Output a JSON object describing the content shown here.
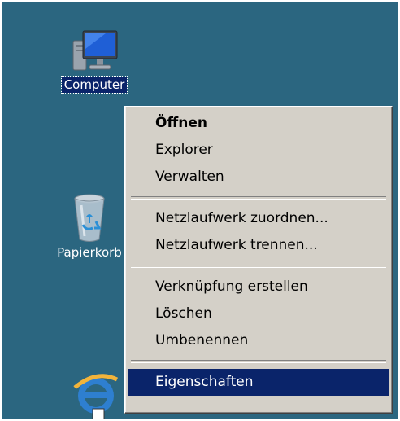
{
  "desktop": {
    "icons": [
      {
        "label": "Computer",
        "icon": "computer-monitor-icon"
      },
      {
        "label": "Papierkorb",
        "icon": "recycle-bin-icon"
      },
      {
        "label": "",
        "icon": "internet-explorer-icon"
      }
    ]
  },
  "context_menu": {
    "items": [
      {
        "label": "Öffnen",
        "bold": true
      },
      {
        "label": "Explorer"
      },
      {
        "label": "Verwalten"
      },
      {
        "label": "Netzlaufwerk zuordnen..."
      },
      {
        "label": "Netzlaufwerk trennen..."
      },
      {
        "label": "Verknüpfung erstellen"
      },
      {
        "label": "Löschen"
      },
      {
        "label": "Umbenennen"
      },
      {
        "label": "Eigenschaften",
        "highlighted": true
      }
    ]
  },
  "colors": {
    "desktop_background": "#2b6680",
    "menu_background": "#d4d0c8",
    "selection": "#0a246a"
  }
}
